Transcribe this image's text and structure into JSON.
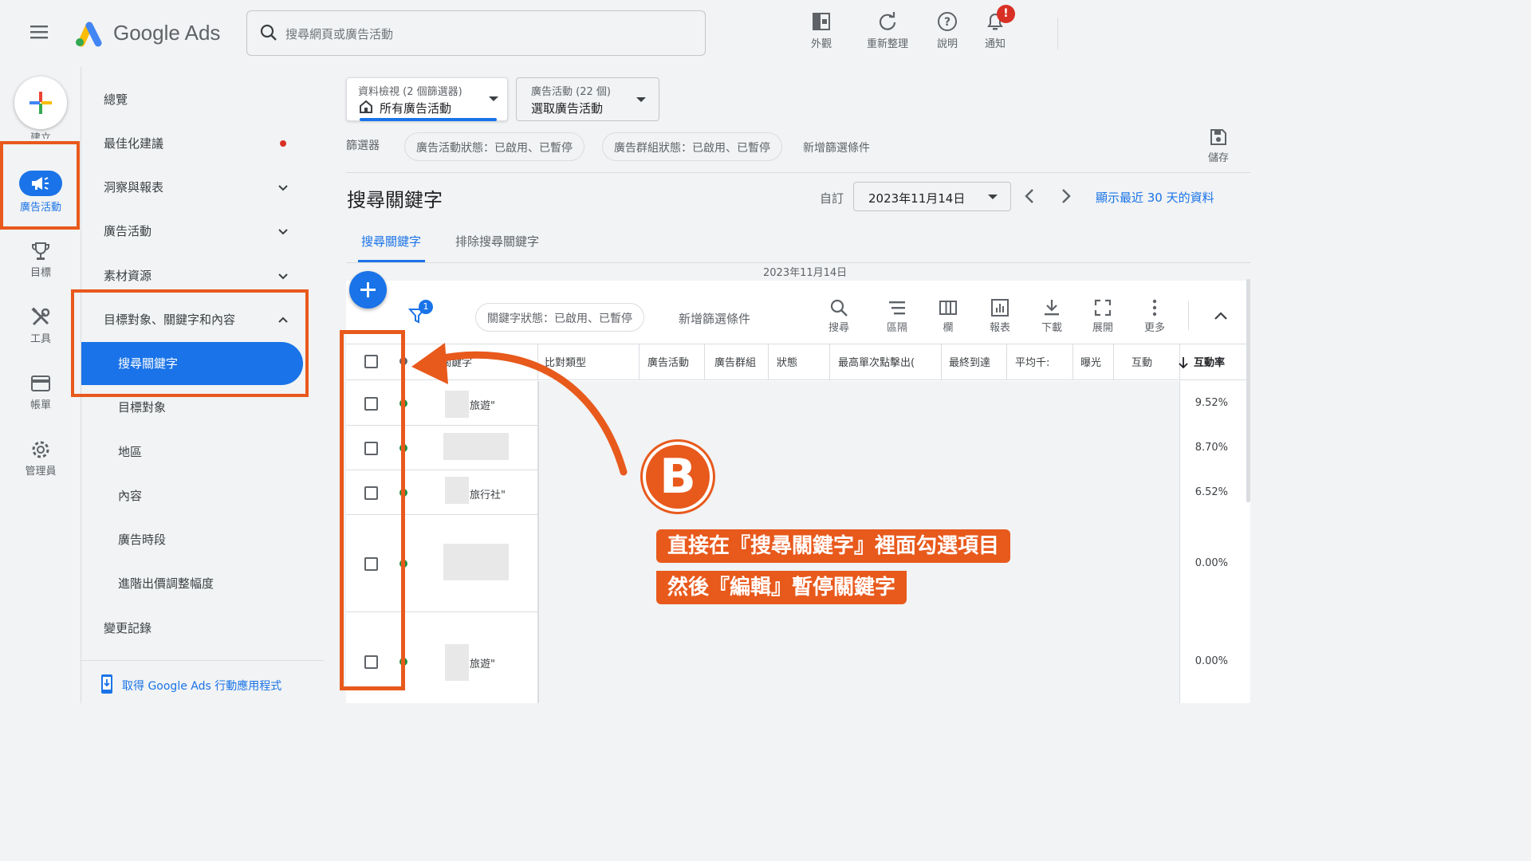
{
  "app": {
    "brand": "Google Ads",
    "brand_colors": [
      "#fbbc04",
      "#4285f4",
      "#34a853"
    ]
  },
  "search": {
    "placeholder": "搜尋網頁或廣告活動"
  },
  "top_tools": [
    {
      "label": "外觀",
      "icon": "appearance-icon"
    },
    {
      "label": "重新整理",
      "icon": "refresh-icon"
    },
    {
      "label": "說明",
      "icon": "help-icon"
    },
    {
      "label": "通知",
      "icon": "bell-icon",
      "badge": "!"
    }
  ],
  "rail": {
    "create": "建立",
    "items": [
      {
        "label": "廣告活動",
        "icon": "megaphone-icon",
        "active": true
      },
      {
        "label": "目標",
        "icon": "trophy-icon"
      },
      {
        "label": "工具",
        "icon": "tools-icon"
      },
      {
        "label": "帳單",
        "icon": "billing-card-icon"
      },
      {
        "label": "管理員",
        "icon": "gear-icon"
      }
    ]
  },
  "nav": {
    "items": [
      {
        "label": "總覽"
      },
      {
        "label": "最佳化建議"
      },
      {
        "label": "洞察與報表"
      },
      {
        "label": "廣告活動"
      },
      {
        "label": "素材資源"
      },
      {
        "label": "目標對象、關鍵字和內容"
      }
    ],
    "sub_items": [
      {
        "label": "搜尋關鍵字",
        "active": true
      },
      {
        "label": "目標對象"
      },
      {
        "label": "地區"
      },
      {
        "label": "內容"
      },
      {
        "label": "廣告時段"
      },
      {
        "label": "進階出價調整幅度"
      }
    ],
    "changelog": "變更記錄",
    "mobile_app": "取得 Google Ads 行動應用程式"
  },
  "selectors": {
    "view": {
      "label": "資料檢視 (2 個篩選器)",
      "value": "所有廣告活動"
    },
    "campaign": {
      "label": "廣告活動 (22 個)",
      "value": "選取廣告活動"
    }
  },
  "filters": {
    "label": "篩選器",
    "chips": [
      "廣告活動狀態：已啟用、已暫停",
      "廣告群組狀態：已啟用、已暫停"
    ],
    "add": "新增篩選條件",
    "save": "儲存"
  },
  "page": {
    "title": "搜尋關鍵字",
    "date_mode": "自訂",
    "date": "2023年11月14日",
    "show_recent": "顯示最近 30 天的資料",
    "tabs": [
      "搜尋關鍵字",
      "排除搜尋關鍵字"
    ],
    "table_date": "2023年11月14日"
  },
  "table_toolbar": {
    "filter_badge": "1",
    "chip": "關鍵字狀態：已啟用、已暫停",
    "add_filter": "新增篩選條件",
    "tools": [
      {
        "label": "搜尋",
        "icon": "search-icon"
      },
      {
        "label": "區隔",
        "icon": "segment-icon"
      },
      {
        "label": "欄",
        "icon": "columns-icon"
      },
      {
        "label": "報表",
        "icon": "report-icon"
      },
      {
        "label": "下載",
        "icon": "download-icon"
      },
      {
        "label": "展開",
        "icon": "expand-icon"
      },
      {
        "label": "更多",
        "icon": "more-icon"
      }
    ]
  },
  "table": {
    "columns": [
      "關鍵字",
      "比對類型",
      "廣告活動",
      "廣告群組",
      "狀態",
      "最高單次點擊出(",
      "最終到達",
      "平均千:",
      "曝光",
      "互動",
      "互動率"
    ],
    "sort_column": "互動率",
    "rows": [
      {
        "keyword_tail": "旅遊\"",
        "ctr": "9.52%"
      },
      {
        "keyword_tail": "",
        "ctr": "8.70%"
      },
      {
        "keyword_tail": "旅行社\"",
        "ctr": "6.52%"
      },
      {
        "keyword_tail": "",
        "ctr": "0.00%"
      },
      {
        "keyword_tail": "旅遊\"",
        "ctr": "0.00%"
      }
    ]
  },
  "annotation": {
    "badge": "B",
    "line1": "直接在『搜尋關鍵字』裡面勾選項目",
    "line2": "然後『編輯』暫停關鍵字",
    "color": "#e8591c"
  }
}
